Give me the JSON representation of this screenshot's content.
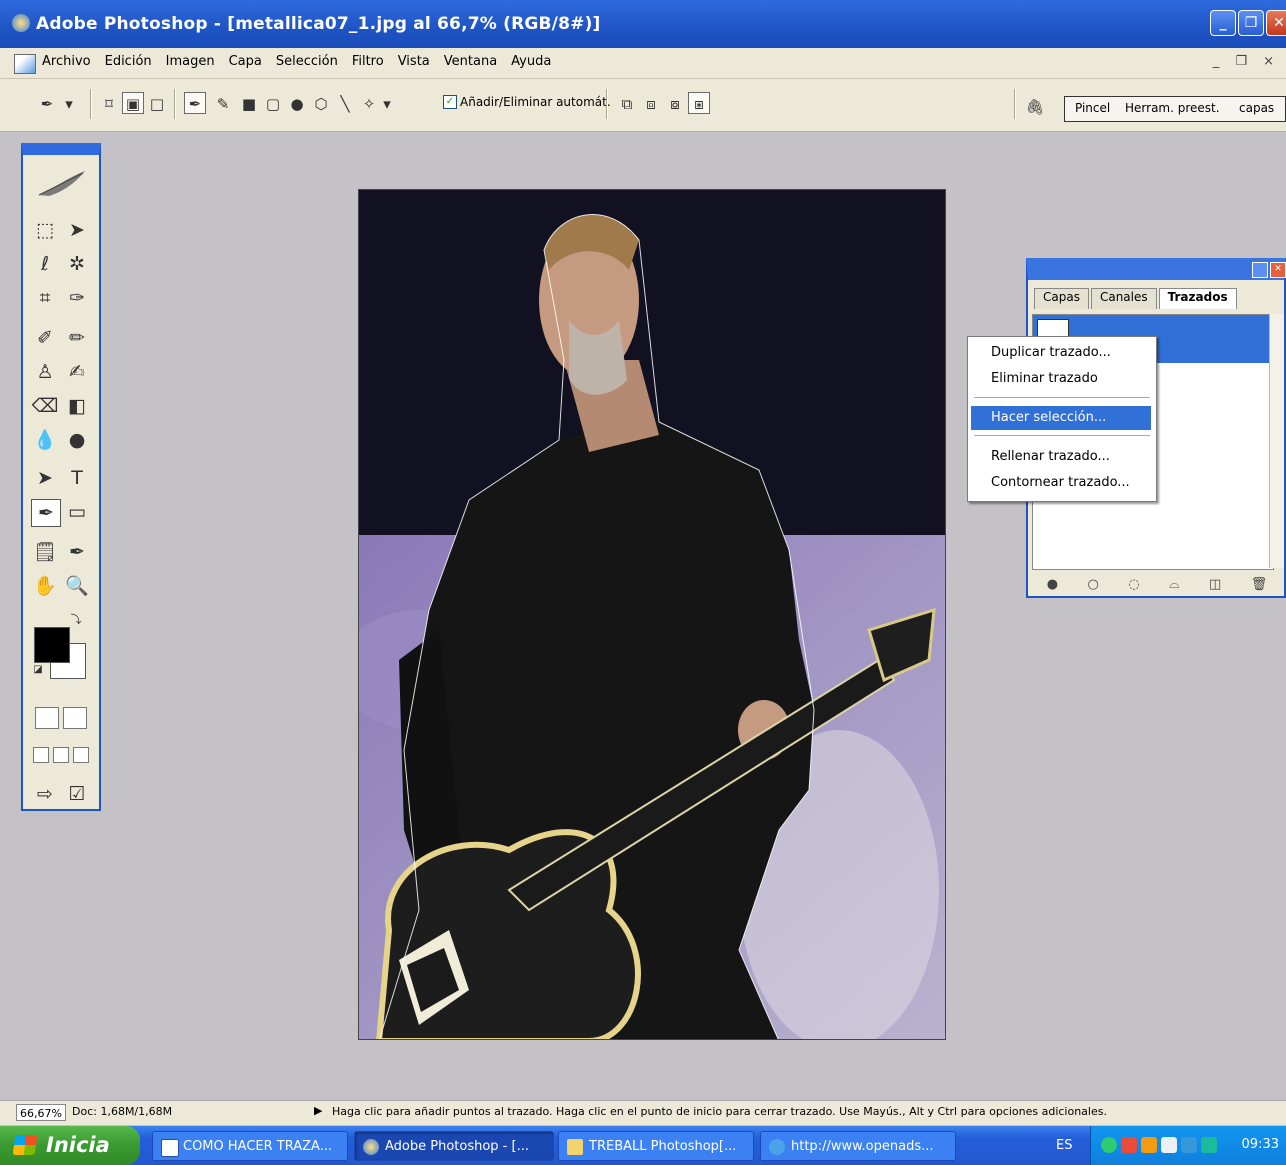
{
  "window": {
    "title": "Adobe Photoshop - [metallica07_1.jpg al 66,7% (RGB/8#)]",
    "controls": [
      "_",
      "❐",
      "✕"
    ]
  },
  "menu": {
    "items": [
      "Archivo",
      "Edición",
      "Imagen",
      "Capa",
      "Selección",
      "Filtro",
      "Vista",
      "Ventana",
      "Ayuda"
    ],
    "mdi_controls": "_ ❐ ×"
  },
  "options_bar": {
    "auto_add_delete_label": "Añadir/Eliminar automát.",
    "auto_add_delete_checked": true,
    "well_tabs": [
      "Pincel",
      "Herram. preest.",
      "capas"
    ]
  },
  "paths_panel": {
    "tabs": [
      "Capas",
      "Canales",
      "Trazados"
    ],
    "active_tab": "Trazados"
  },
  "context_menu": {
    "items": [
      "Duplicar trazado...",
      "Eliminar trazado",
      "Hacer selección...",
      "Rellenar trazado...",
      "Contornear trazado..."
    ],
    "highlighted": "Hacer selección..."
  },
  "status_bar": {
    "zoom": "66,67%",
    "doc_size": "Doc: 1,68M/1,68M",
    "message": "Haga clic para añadir puntos al trazado. Haga clic en el punto de inicio para cerrar trazado. Use Mayús., Alt y Ctrl para opciones adicionales."
  },
  "taskbar": {
    "start_label": "Inicia",
    "tasks": [
      "COMO HACER TRAZA...",
      "Adobe Photoshop - [...",
      "TREBALL Photoshop[...",
      "http://www.openads..."
    ],
    "active_task": "Adobe Photoshop - [...",
    "language": "ES",
    "clock": "09:33"
  },
  "colors": {
    "titlebar": "#2f6bde",
    "menu_highlight": "#3170d6",
    "workspace": "#c4c2c7",
    "start_button": "#3a9a31"
  }
}
